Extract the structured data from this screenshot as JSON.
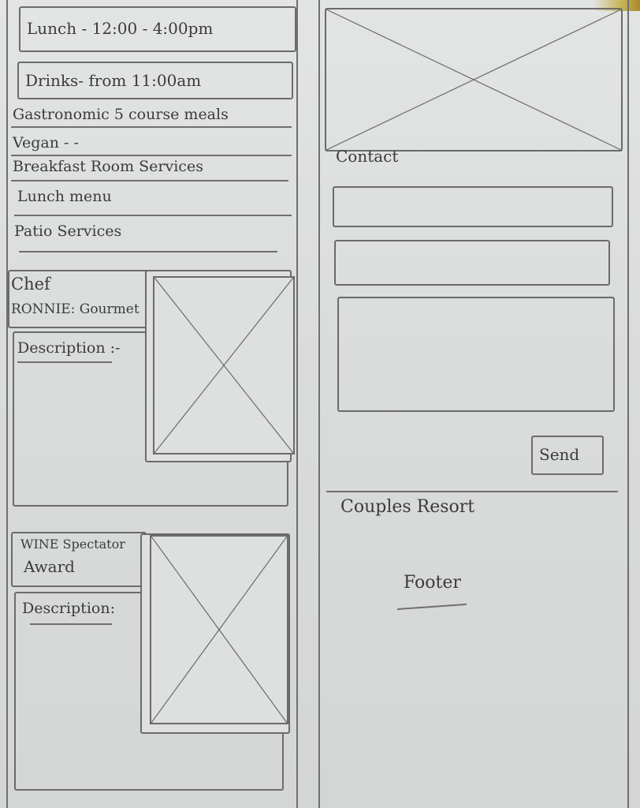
{
  "menu": {
    "lunch_box": "Lunch - 12:00 - 4:00pm",
    "drinks_box": "Drinks- from 11:00am",
    "items": [
      "Gastronomic 5 course meals",
      "Vegan - -",
      "Breakfast Room Services",
      "Lunch menu",
      "Patio Services"
    ]
  },
  "chef": {
    "title": "Chef",
    "name": "RONNIE: Gourmet",
    "description_label": "Description :-"
  },
  "wine": {
    "title_line1": "WINE Spectator",
    "title_line2": "Award",
    "description_label": "Description:"
  },
  "contact": {
    "heading": "Contact",
    "send_label": "Send"
  },
  "footer": {
    "brand": "Couples Resort",
    "label": "Footer"
  }
}
